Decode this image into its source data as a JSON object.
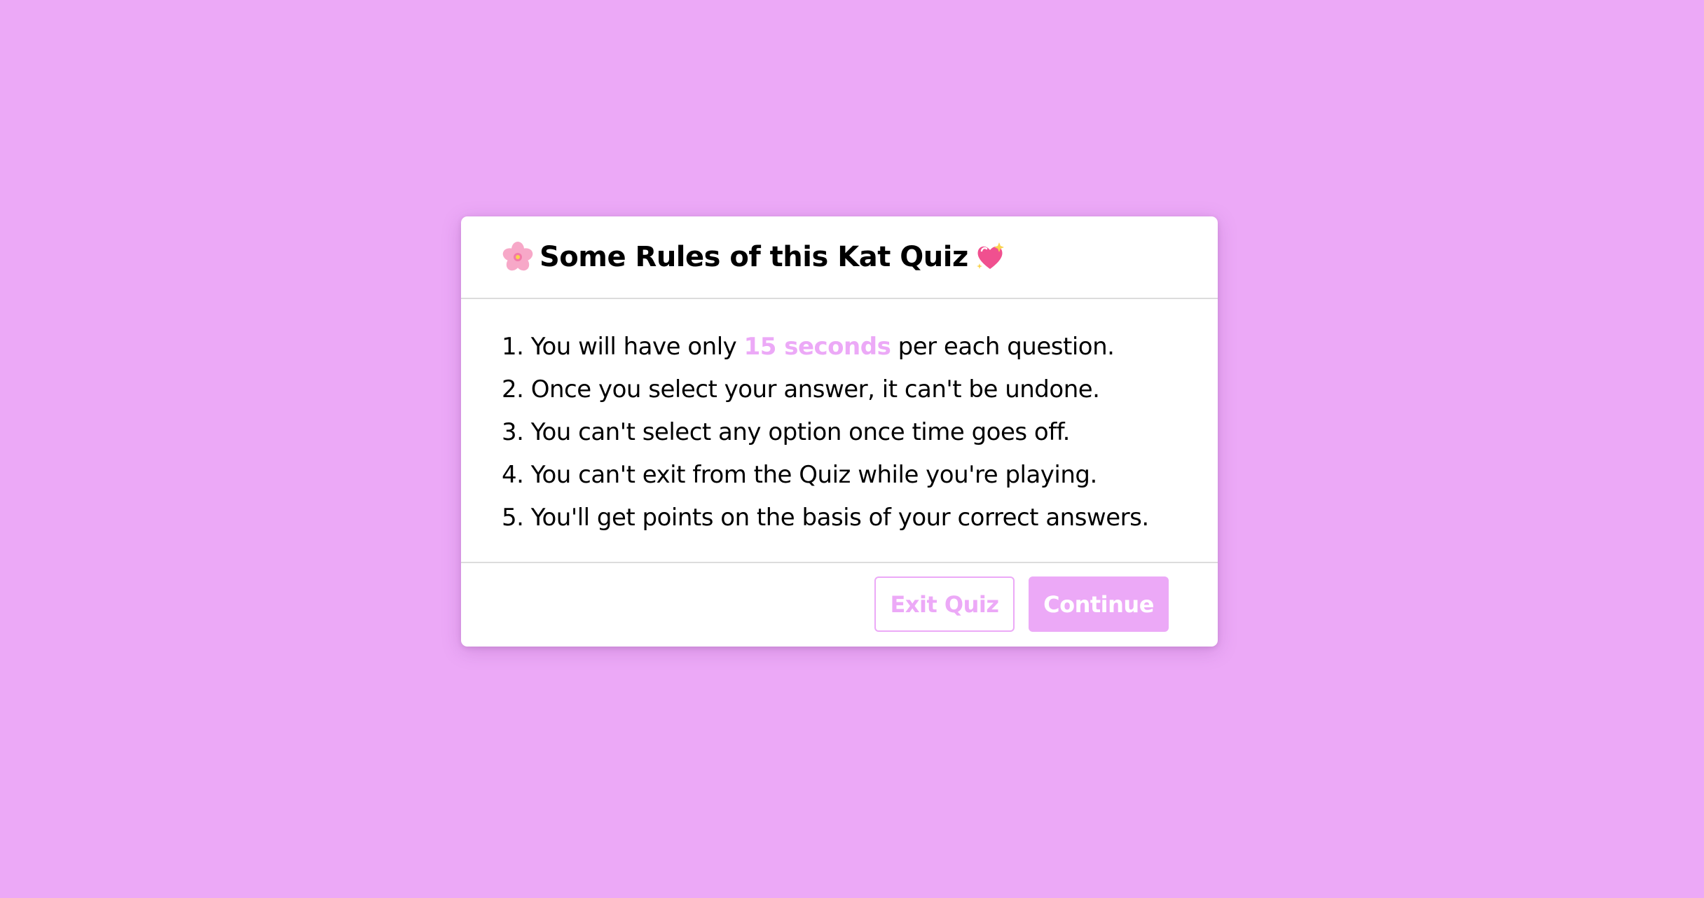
{
  "dialog": {
    "title": "Some Rules of this Kat Quiz",
    "title_leading_icon": "cherry-blossom-icon",
    "title_trailing_icon": "sparkling-heart-icon",
    "rules": [
      {
        "before": "1. You will have only ",
        "highlight": "15 seconds",
        "after": " per each question."
      },
      {
        "text": "2. Once you select your answer, it can't be undone."
      },
      {
        "text": "3. You can't select any option once time goes off."
      },
      {
        "text": "4. You can't exit from the Quiz while you're playing."
      },
      {
        "text": "5. You'll get points on the basis of your correct answers."
      }
    ],
    "buttons": {
      "exit_label": "Exit Quiz",
      "continue_label": "Continue"
    }
  },
  "colors": {
    "background": "#eca9f7",
    "accent": "#eca9f7",
    "card": "#ffffff",
    "text": "#000000"
  }
}
